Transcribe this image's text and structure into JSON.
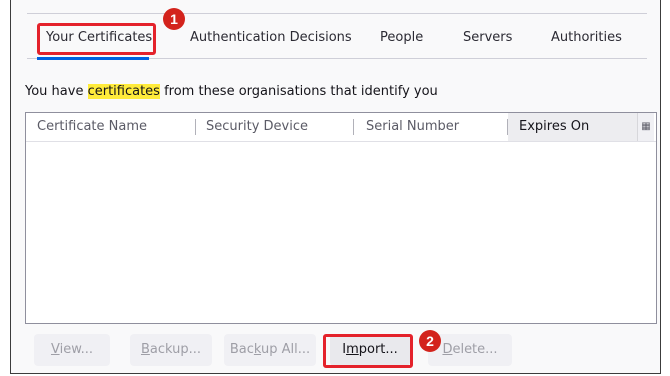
{
  "tabs": [
    {
      "label": "Your Certificates",
      "selected": true
    },
    {
      "label": "Authentication Decisions",
      "selected": false
    },
    {
      "label": "People",
      "selected": false
    },
    {
      "label": "Servers",
      "selected": false
    },
    {
      "label": "Authorities",
      "selected": false
    }
  ],
  "intro": {
    "before": "You have ",
    "highlight": "certificates",
    "after": " from these organisations that identify you"
  },
  "table": {
    "columns": [
      "Certificate Name",
      "Security Device",
      "Serial Number",
      "Expires On"
    ],
    "sorted_column": "Expires On",
    "rows": []
  },
  "buttons": [
    {
      "pre": "",
      "key": "V",
      "post": "iew...",
      "enabled": false
    },
    {
      "pre": "",
      "key": "B",
      "post": "ackup...",
      "enabled": false
    },
    {
      "pre": "Bac",
      "key": "k",
      "post": "up All...",
      "enabled": false
    },
    {
      "pre": "I",
      "key": "m",
      "post": "port...",
      "enabled": true
    },
    {
      "pre": "",
      "key": "D",
      "post": "elete...",
      "enabled": false
    }
  ],
  "annotations": {
    "step1": "1",
    "step2": "2"
  },
  "colors": {
    "callout": "#e4222b",
    "highlight": "#ffeb3b",
    "accent": "#0061e0"
  }
}
